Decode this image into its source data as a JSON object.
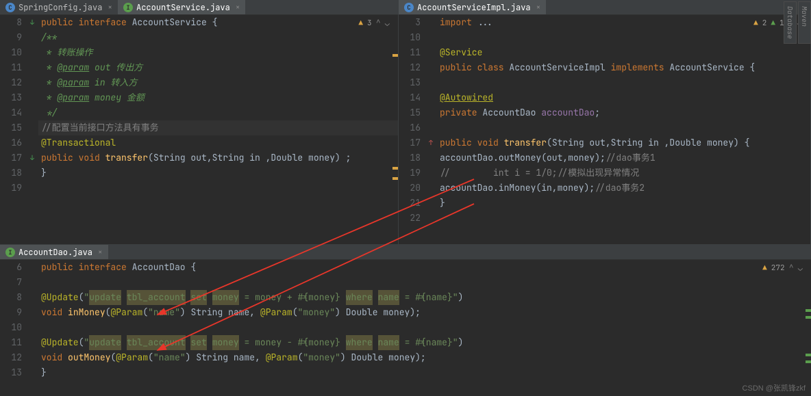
{
  "leftPane": {
    "tabs": [
      {
        "icon": "C",
        "label": "SpringConfig.java",
        "active": false
      },
      {
        "icon": "I",
        "label": "AccountService.java",
        "active": true
      }
    ],
    "warnings": "3",
    "lines": [
      {
        "n": "8",
        "mark": "↓",
        "html": "<span class='kw'>public interface </span><span class='txt'>AccountService {</span>"
      },
      {
        "n": "9",
        "html": "    <span class='doc'>/**</span>"
      },
      {
        "n": "10",
        "html": "    <span class='doc'> * 转账操作</span>"
      },
      {
        "n": "11",
        "html": "    <span class='doc'> * </span><span class='doctag'>@param</span><span class='doc'> out 传出方</span>"
      },
      {
        "n": "12",
        "html": "    <span class='doc'> * </span><span class='doctag'>@param</span><span class='doc'> in 转入方</span>"
      },
      {
        "n": "13",
        "html": "    <span class='doc'> * </span><span class='doctag'>@param</span><span class='doc'> money 金额</span>"
      },
      {
        "n": "14",
        "html": "    <span class='doc'> */</span>"
      },
      {
        "n": "15",
        "current": true,
        "html": "    <span class='cmt'>//配置当前接口方法具有事务</span>"
      },
      {
        "n": "16",
        "html": "    <span class='ann'>@Transactional</span>"
      },
      {
        "n": "17",
        "mark": "↓",
        "html": "    <span class='kw'>public void </span><span class='mtd'>transfer</span><span class='txt'>(String out,String in ,Double money) ;</span>"
      },
      {
        "n": "18",
        "html": "<span class='txt'>}</span>"
      },
      {
        "n": "19",
        "html": ""
      }
    ]
  },
  "rightPane": {
    "tabs": [
      {
        "icon": "C",
        "label": "AccountServiceImpl.java",
        "active": true
      }
    ],
    "warnings": "2",
    "warnings2": "1",
    "lines": [
      {
        "n": "3",
        "html": "<span class='kw'>import </span><span class='txt'>...</span>"
      },
      {
        "n": "10",
        "html": ""
      },
      {
        "n": "11",
        "html": "<span class='ann'>@Service</span>"
      },
      {
        "n": "12",
        "html": "<span class='kw'>public class </span><span class='txt'>AccountServiceImpl </span><span class='kw'>implements </span><span class='txt'>AccountService {</span>"
      },
      {
        "n": "13",
        "html": ""
      },
      {
        "n": "14",
        "html": "    <span class='ann' style='text-decoration:underline'>@Autowired</span>"
      },
      {
        "n": "15",
        "html": "    <span class='kw'>private </span><span class='txt'>AccountDao </span><span class='txt' style='color:#9876aa'>accountDao</span><span class='txt'>;</span>"
      },
      {
        "n": "16",
        "html": ""
      },
      {
        "n": "17",
        "mark": "↑",
        "html": "    <span class='kw'>public void </span><span class='mtd'>transfer</span><span class='txt'>(String out,String in ,Double money) {</span>"
      },
      {
        "n": "18",
        "html": "        <span class='txt'>accountDao.outMoney(out,money);</span><span class='cmt'>//dao事务1</span>"
      },
      {
        "n": "19",
        "html": "<span class='cmt'>//        int i = 1/0;//模拟出现异常情况</span>"
      },
      {
        "n": "20",
        "html": "        <span class='txt'>accountDao.inMoney(in,money);</span><span class='cmt'>//dao事务2</span>"
      },
      {
        "n": "21",
        "html": "    <span class='txt'>}</span>"
      },
      {
        "n": "22",
        "html": ""
      }
    ]
  },
  "bottomPane": {
    "tabs": [
      {
        "icon": "I",
        "label": "AccountDao.java",
        "active": true
      }
    ],
    "warnings": "272",
    "lines": [
      {
        "n": "6",
        "html": "<span class='kw'>public interface </span><span class='txt'>AccountDao {</span>"
      },
      {
        "n": "7",
        "html": ""
      },
      {
        "n": "8",
        "html": "    <span class='ann'>@Update</span><span class='txt'>(</span><span class='str'>\"</span><span class='str hi'>update</span><span class='str'> </span><span class='str hi'>tbl_account</span><span class='str'> </span><span class='str hi'>set</span><span class='str'> </span><span class='str hi'>money</span><span class='str'> = money + #{money} </span><span class='str hi'>where</span><span class='str'> </span><span class='str hi'>name</span><span class='str'> = #{name}\"</span><span class='txt'>)</span>"
      },
      {
        "n": "9",
        "html": "    <span class='kw'>void </span><span class='mtd'>inMoney</span><span class='txt'>(</span><span class='ann'>@Param</span><span class='txt'>(</span><span class='str'>\"name\"</span><span class='txt'>) String name, </span><span class='ann'>@Param</span><span class='txt'>(</span><span class='str'>\"money\"</span><span class='txt'>) Double money);</span>"
      },
      {
        "n": "10",
        "html": ""
      },
      {
        "n": "11",
        "html": "    <span class='ann'>@Update</span><span class='txt'>(</span><span class='str'>\"</span><span class='str hi'>update</span><span class='str'> </span><span class='str hi'>tbl_account</span><span class='str'> </span><span class='str hi'>set</span><span class='str'> </span><span class='str hi'>money</span><span class='str'> = money - #{money} </span><span class='str hi'>where</span><span class='str'> </span><span class='str hi'>name</span><span class='str'> = #{name}\"</span><span class='txt'>)</span>"
      },
      {
        "n": "12",
        "html": "    <span class='kw'>void </span><span class='mtd'>outMoney</span><span class='txt'>(</span><span class='ann'>@Param</span><span class='txt'>(</span><span class='str'>\"name\"</span><span class='txt'>) String name, </span><span class='ann'>@Param</span><span class='txt'>(</span><span class='str'>\"money\"</span><span class='txt'>) Double money);</span>"
      },
      {
        "n": "13",
        "html": "<span class='txt'>}</span>"
      }
    ]
  },
  "sideTabs": [
    "Maven",
    "Database"
  ],
  "watermark": "CSDN @张凯锋zkf"
}
